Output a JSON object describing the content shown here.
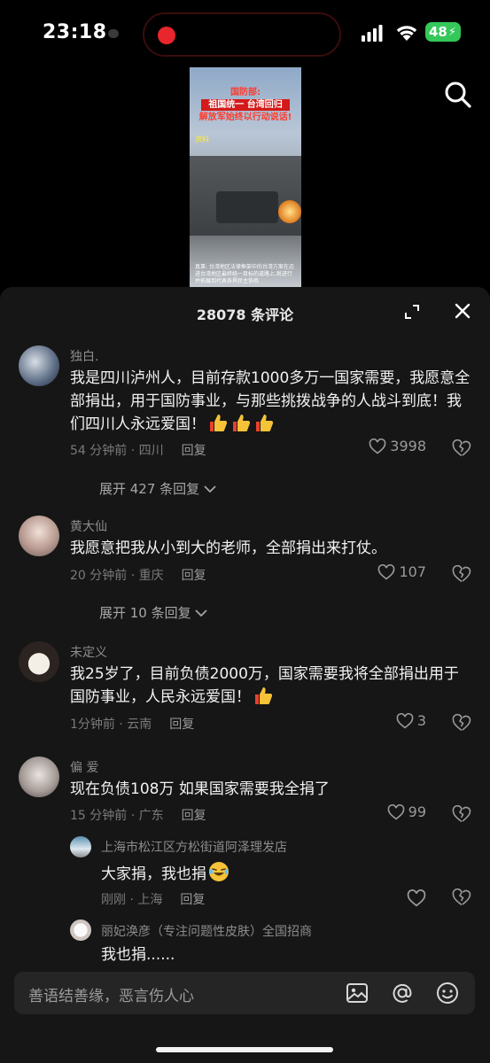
{
  "status_bar": {
    "time": "23:18",
    "battery": "48"
  },
  "video": {
    "title_line1": "国防部:",
    "title_line2": "祖国统一 台湾回归",
    "title_line3": "解放军始终以行动说话!",
    "source": "资料",
    "caption": "真事: 台湾地区法律框架中的台湾方案在迈进台湾地区最终统一目标的道路上,就进行并拓展到代表各界民主协商"
  },
  "sheet": {
    "title": "28078 条评论"
  },
  "comments": [
    {
      "username": "独白.",
      "text": "我是四川泸州人，目前存款1000多万一国家需要，我愿意全部捐出，用于国防事业，与那些挑拨战争的人战斗到底！我们四川人永远爱国！",
      "emoji_count": 3,
      "time_location": "54 分钟前 · 四川",
      "reply": "回复",
      "likes": "3998",
      "expand": "展开 427 条回复"
    },
    {
      "username": "黄大仙",
      "text": "我愿意把我从小到大的老师，全部捐出来打仗。",
      "time_location": "20 分钟前 · 重庆",
      "reply": "回复",
      "likes": "107",
      "expand": "展开 10 条回复"
    },
    {
      "username": "未定义",
      "text": "我25岁了，目前负债2000万，国家需要我将全部捐出用于国防事业，人民永远爱国！",
      "emoji_count": 1,
      "time_location": "1分钟前 · 云南",
      "reply": "回复",
      "likes": "3"
    },
    {
      "username": "偏  爱",
      "text": "现在负债108万 如果国家需要我全捐了",
      "time_location": "15 分钟前 · 广东",
      "reply": "回复",
      "likes": "99"
    }
  ],
  "replies": [
    {
      "username": "上海市松江区方松街道阿泽理发店",
      "text": "大家捐，我也捐",
      "time_location": "刚刚 · 上海",
      "reply": "回复"
    },
    {
      "username": "丽妃涣彦（专注问题性皮肤）全国招商",
      "text": "我也捐......"
    }
  ],
  "input": {
    "placeholder": "善语结善缘，恶言伤人心"
  },
  "icon_names": [
    "search-icon",
    "expand-icon",
    "close-icon",
    "heart-icon",
    "broken-heart-icon",
    "chevron-down-icon",
    "image-icon",
    "at-icon",
    "emoji-icon",
    "thumbs-up-emoji",
    "laughing-emoji"
  ],
  "colors": {
    "background": "#000000",
    "sheet": "#161616",
    "text_primary": "#f2f2f2",
    "text_secondary": "#7a7a7a",
    "battery": "#34c759",
    "record": "#e8262c"
  }
}
